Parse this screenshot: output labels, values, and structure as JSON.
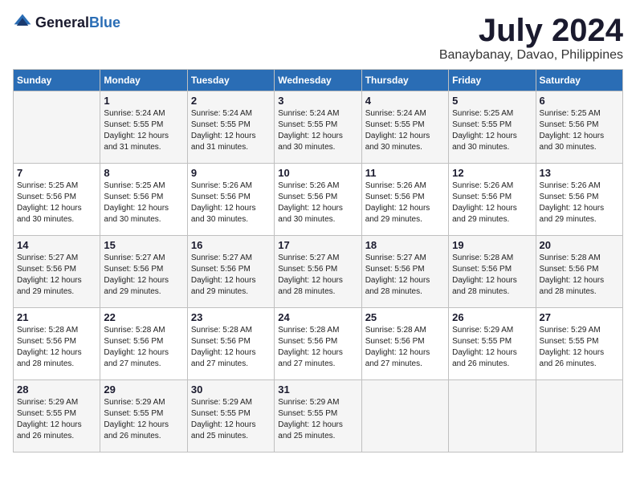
{
  "header": {
    "logo_general": "General",
    "logo_blue": "Blue",
    "month_title": "July 2024",
    "subtitle": "Banaybanay, Davao, Philippines"
  },
  "days_of_week": [
    "Sunday",
    "Monday",
    "Tuesday",
    "Wednesday",
    "Thursday",
    "Friday",
    "Saturday"
  ],
  "weeks": [
    [
      {
        "day": "",
        "info": ""
      },
      {
        "day": "1",
        "info": "Sunrise: 5:24 AM\nSunset: 5:55 PM\nDaylight: 12 hours\nand 31 minutes."
      },
      {
        "day": "2",
        "info": "Sunrise: 5:24 AM\nSunset: 5:55 PM\nDaylight: 12 hours\nand 31 minutes."
      },
      {
        "day": "3",
        "info": "Sunrise: 5:24 AM\nSunset: 5:55 PM\nDaylight: 12 hours\nand 30 minutes."
      },
      {
        "day": "4",
        "info": "Sunrise: 5:24 AM\nSunset: 5:55 PM\nDaylight: 12 hours\nand 30 minutes."
      },
      {
        "day": "5",
        "info": "Sunrise: 5:25 AM\nSunset: 5:55 PM\nDaylight: 12 hours\nand 30 minutes."
      },
      {
        "day": "6",
        "info": "Sunrise: 5:25 AM\nSunset: 5:56 PM\nDaylight: 12 hours\nand 30 minutes."
      }
    ],
    [
      {
        "day": "7",
        "info": "Sunrise: 5:25 AM\nSunset: 5:56 PM\nDaylight: 12 hours\nand 30 minutes."
      },
      {
        "day": "8",
        "info": "Sunrise: 5:25 AM\nSunset: 5:56 PM\nDaylight: 12 hours\nand 30 minutes."
      },
      {
        "day": "9",
        "info": "Sunrise: 5:26 AM\nSunset: 5:56 PM\nDaylight: 12 hours\nand 30 minutes."
      },
      {
        "day": "10",
        "info": "Sunrise: 5:26 AM\nSunset: 5:56 PM\nDaylight: 12 hours\nand 30 minutes."
      },
      {
        "day": "11",
        "info": "Sunrise: 5:26 AM\nSunset: 5:56 PM\nDaylight: 12 hours\nand 29 minutes."
      },
      {
        "day": "12",
        "info": "Sunrise: 5:26 AM\nSunset: 5:56 PM\nDaylight: 12 hours\nand 29 minutes."
      },
      {
        "day": "13",
        "info": "Sunrise: 5:26 AM\nSunset: 5:56 PM\nDaylight: 12 hours\nand 29 minutes."
      }
    ],
    [
      {
        "day": "14",
        "info": "Sunrise: 5:27 AM\nSunset: 5:56 PM\nDaylight: 12 hours\nand 29 minutes."
      },
      {
        "day": "15",
        "info": "Sunrise: 5:27 AM\nSunset: 5:56 PM\nDaylight: 12 hours\nand 29 minutes."
      },
      {
        "day": "16",
        "info": "Sunrise: 5:27 AM\nSunset: 5:56 PM\nDaylight: 12 hours\nand 29 minutes."
      },
      {
        "day": "17",
        "info": "Sunrise: 5:27 AM\nSunset: 5:56 PM\nDaylight: 12 hours\nand 28 minutes."
      },
      {
        "day": "18",
        "info": "Sunrise: 5:27 AM\nSunset: 5:56 PM\nDaylight: 12 hours\nand 28 minutes."
      },
      {
        "day": "19",
        "info": "Sunrise: 5:28 AM\nSunset: 5:56 PM\nDaylight: 12 hours\nand 28 minutes."
      },
      {
        "day": "20",
        "info": "Sunrise: 5:28 AM\nSunset: 5:56 PM\nDaylight: 12 hours\nand 28 minutes."
      }
    ],
    [
      {
        "day": "21",
        "info": "Sunrise: 5:28 AM\nSunset: 5:56 PM\nDaylight: 12 hours\nand 28 minutes."
      },
      {
        "day": "22",
        "info": "Sunrise: 5:28 AM\nSunset: 5:56 PM\nDaylight: 12 hours\nand 27 minutes."
      },
      {
        "day": "23",
        "info": "Sunrise: 5:28 AM\nSunset: 5:56 PM\nDaylight: 12 hours\nand 27 minutes."
      },
      {
        "day": "24",
        "info": "Sunrise: 5:28 AM\nSunset: 5:56 PM\nDaylight: 12 hours\nand 27 minutes."
      },
      {
        "day": "25",
        "info": "Sunrise: 5:28 AM\nSunset: 5:56 PM\nDaylight: 12 hours\nand 27 minutes."
      },
      {
        "day": "26",
        "info": "Sunrise: 5:29 AM\nSunset: 5:55 PM\nDaylight: 12 hours\nand 26 minutes."
      },
      {
        "day": "27",
        "info": "Sunrise: 5:29 AM\nSunset: 5:55 PM\nDaylight: 12 hours\nand 26 minutes."
      }
    ],
    [
      {
        "day": "28",
        "info": "Sunrise: 5:29 AM\nSunset: 5:55 PM\nDaylight: 12 hours\nand 26 minutes."
      },
      {
        "day": "29",
        "info": "Sunrise: 5:29 AM\nSunset: 5:55 PM\nDaylight: 12 hours\nand 26 minutes."
      },
      {
        "day": "30",
        "info": "Sunrise: 5:29 AM\nSunset: 5:55 PM\nDaylight: 12 hours\nand 25 minutes."
      },
      {
        "day": "31",
        "info": "Sunrise: 5:29 AM\nSunset: 5:55 PM\nDaylight: 12 hours\nand 25 minutes."
      },
      {
        "day": "",
        "info": ""
      },
      {
        "day": "",
        "info": ""
      },
      {
        "day": "",
        "info": ""
      }
    ]
  ]
}
